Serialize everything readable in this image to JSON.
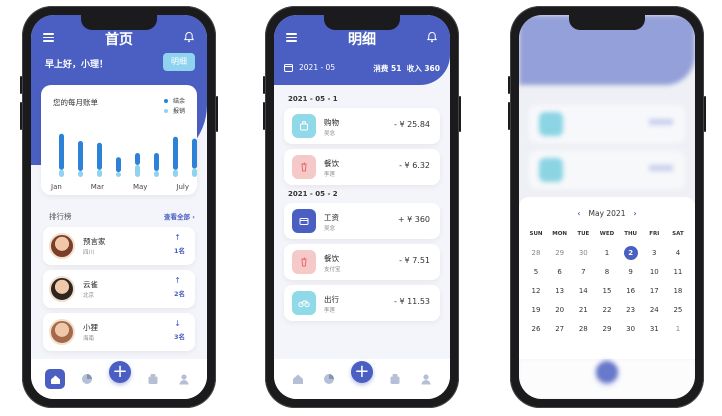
{
  "screen1": {
    "title": "首页",
    "greeting": "早上好，小理！",
    "detail_button": "明细",
    "chart_card": {
      "title": "您的每月账单",
      "legend": [
        {
          "label": "结余",
          "color": "#2d82d8"
        },
        {
          "label": "报销",
          "color": "#8fd3ee"
        }
      ],
      "months": [
        "Jan",
        "Mar",
        "May",
        "July"
      ]
    },
    "chart_data": {
      "type": "bar",
      "series": [
        {
          "name": "结余",
          "values": [
            0.6,
            0.5,
            0.45,
            0.25,
            0.2,
            0.3,
            0.55,
            0.5
          ]
        },
        {
          "name": "报销",
          "values": [
            0.12,
            0.1,
            0.12,
            0.08,
            0.2,
            0.1,
            0.12,
            0.14
          ]
        }
      ],
      "xlabels": [
        "Jan",
        "Mar",
        "May",
        "July"
      ]
    },
    "ranking_label": "排行榜",
    "view_all": "查看全部",
    "ranking": [
      {
        "name": "预言家",
        "city": "四川",
        "rank": "1名",
        "dir": "↑"
      },
      {
        "name": "云雀",
        "city": "北京",
        "rank": "2名",
        "dir": "↑"
      },
      {
        "name": "小狸",
        "city": "海南",
        "rank": "3名",
        "dir": "↓"
      }
    ]
  },
  "screen2": {
    "title": "明细",
    "date": "2021 - 05",
    "expense": "消费 51",
    "income": "收入 360",
    "groups": [
      {
        "date": "2021 - 05 - 1",
        "items": [
          {
            "name": "购物",
            "sub": "吴念",
            "amount": "- ¥ 25.84",
            "icon": "bag-icon",
            "bg": "#8fd9e8"
          },
          {
            "name": "餐饮",
            "sub": "李莲",
            "amount": "- ¥ 6.32",
            "icon": "drink-icon",
            "bg": "#f6c9c9"
          }
        ]
      },
      {
        "date": "2021 - 05 - 2",
        "items": [
          {
            "name": "工资",
            "sub": "吴念",
            "amount": "+ ¥ 360",
            "icon": "wallet-icon",
            "bg": "#4a5fc1"
          },
          {
            "name": "餐饮",
            "sub": "支付宝",
            "amount": "- ¥ 7.51",
            "icon": "drink-icon",
            "bg": "#f6c9c9"
          },
          {
            "name": "出行",
            "sub": "李莲",
            "amount": "- ¥ 11.53",
            "icon": "bike-icon",
            "bg": "#8fd9e8"
          }
        ]
      }
    ]
  },
  "screen3": {
    "month_label": "May 2021",
    "weekdays": [
      "SUN",
      "MON",
      "TUE",
      "WED",
      "THU",
      "FRI",
      "SAT"
    ],
    "weeks": [
      [
        "28",
        "29",
        "30",
        "1",
        "2",
        "3",
        "4"
      ],
      [
        "5",
        "6",
        "7",
        "8",
        "9",
        "10",
        "11"
      ],
      [
        "12",
        "13",
        "14",
        "15",
        "16",
        "17",
        "18"
      ],
      [
        "19",
        "20",
        "21",
        "22",
        "23",
        "24",
        "25"
      ],
      [
        "26",
        "27",
        "28",
        "29",
        "30",
        "31",
        "1"
      ]
    ],
    "selected": "2"
  },
  "colors": {
    "accent": "#4a5fc1",
    "bg": "#f4f5fa"
  }
}
